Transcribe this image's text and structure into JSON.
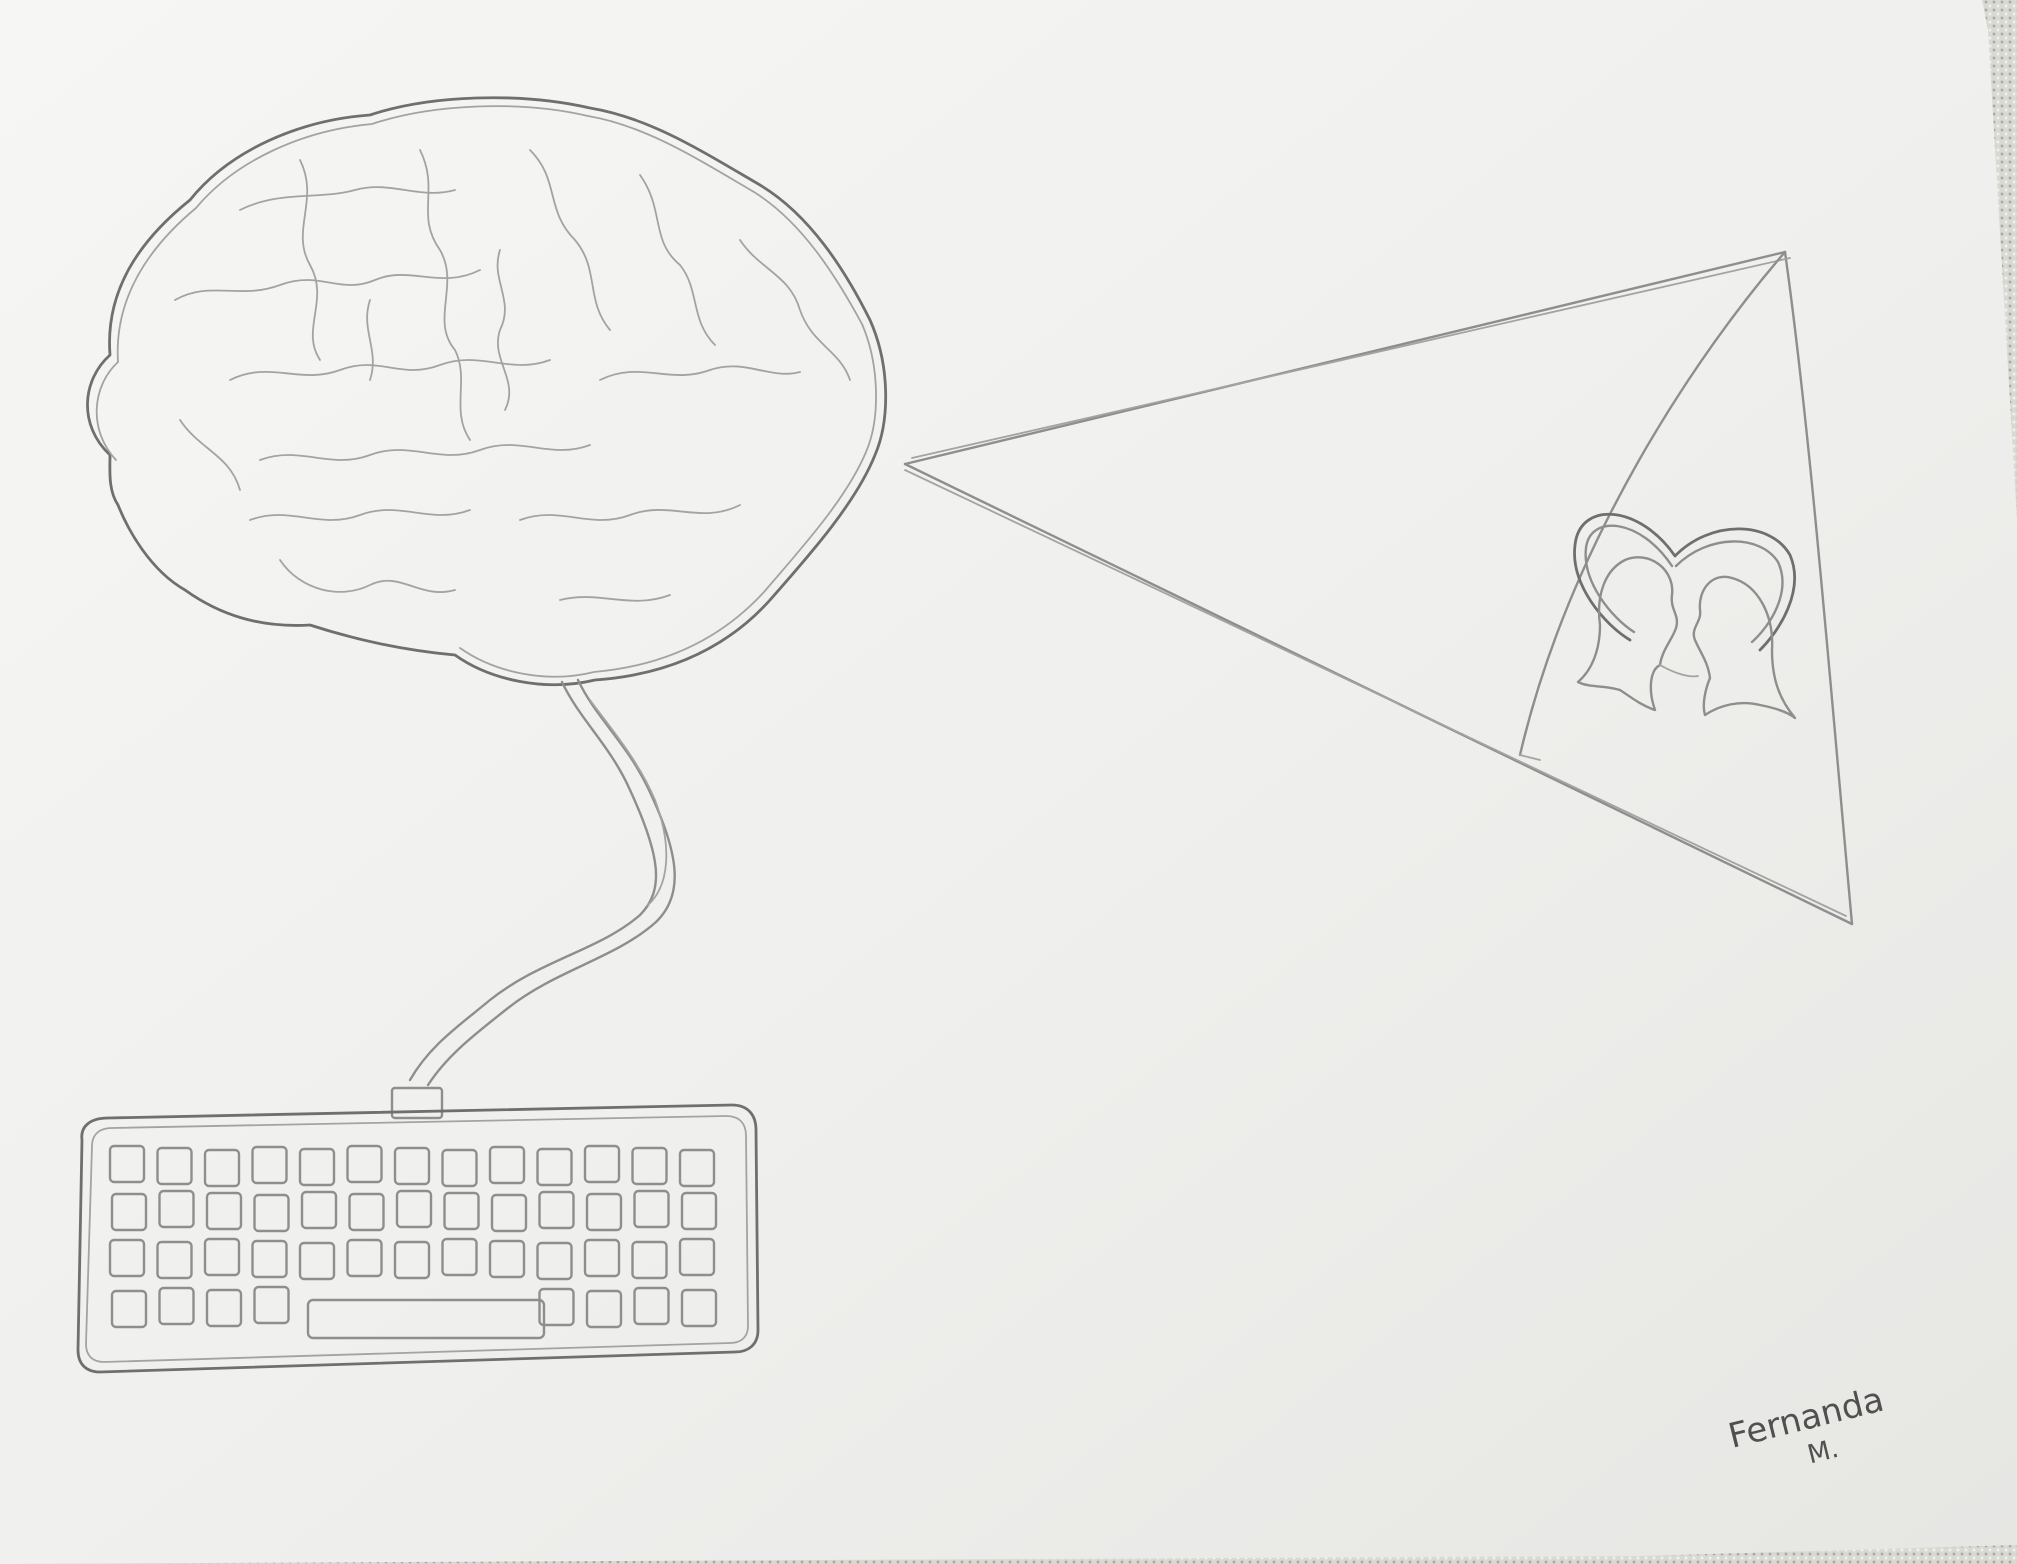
{
  "drawing": {
    "signature_name": "Fernanda",
    "signature_initial": "M."
  },
  "icons": {
    "brain": "brain-sketch",
    "cable": "cable-sketch",
    "keyboard": "keyboard-sketch",
    "projection": "light-beam-triangle",
    "couple": "kissing-couple-heart"
  },
  "colors": {
    "paper": "#f3f3f1",
    "pencil": "#8e8e8e"
  }
}
